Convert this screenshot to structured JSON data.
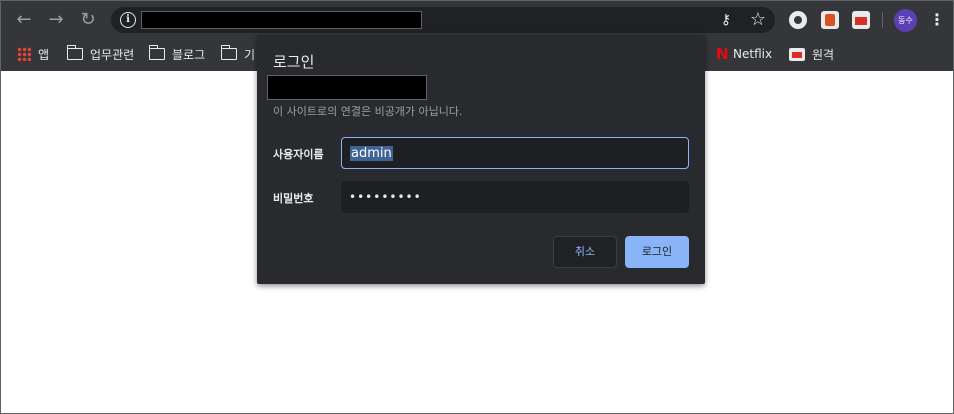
{
  "browser": {
    "nav": {
      "back": "←",
      "forward": "→",
      "reload": "↻"
    },
    "omnibox": {
      "info_glyph": "i",
      "key_glyph": "⚷",
      "star_glyph": "☆"
    },
    "profile_initials": "동수",
    "menu_glyph": "⋮"
  },
  "bookmarks": {
    "items": [
      {
        "label": "앱",
        "icon": "apps-icon"
      },
      {
        "label": "업무관련",
        "icon": "folder-icon"
      },
      {
        "label": "블로그",
        "icon": "folder-icon"
      },
      {
        "label": "기",
        "icon": "folder-icon"
      },
      {
        "label": "Netflix",
        "icon": "netflix-icon"
      },
      {
        "label": "원격",
        "icon": "remote-icon"
      }
    ]
  },
  "dialog": {
    "title": "로그인",
    "notice": "이 사이트로의 연결은 비공개가 아닙니다.",
    "username_label": "사용자이름",
    "username_value": "admin",
    "password_label": "비밀번호",
    "password_mask": "•••••••••",
    "cancel_label": "취소",
    "login_label": "로그인"
  },
  "colors": {
    "toolbar": "#35363a",
    "dialog_bg": "#292a2d",
    "accent": "#8ab4f8"
  }
}
